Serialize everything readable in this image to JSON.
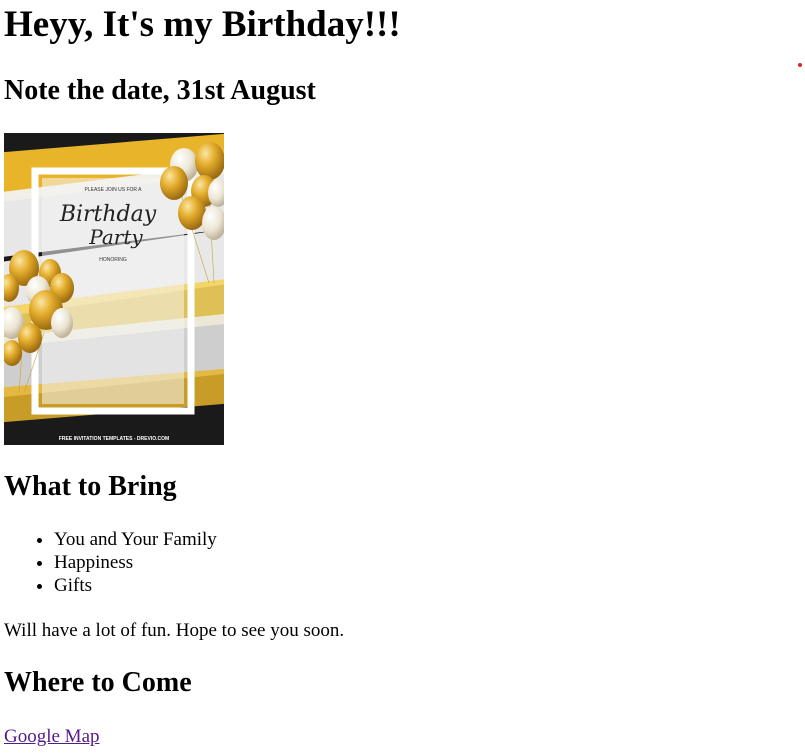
{
  "title": "Heyy, It's my Birthday!!!",
  "date_heading": "Note the date, 31st August",
  "invite_card": {
    "line1": "PLEASE JOIN US FOR A",
    "script1": "Birthday",
    "script2": "Party",
    "line2": "HONORING",
    "footer": "FREE INVITATION TEMPLATES - DREVIO.COM",
    "colors": {
      "gold": "#e8b52a",
      "dark": "#1a1a1a",
      "frame": "#ffffff"
    }
  },
  "bring_heading": "What to Bring",
  "bring_items": [
    "You and Your Family",
    "Happiness",
    "Gifts"
  ],
  "closing_text": "Will have a lot of fun. Hope to see you soon.",
  "where_heading": "Where to Come",
  "map_link": "Google Map",
  "colors": {
    "link_visited": "#551a8b",
    "dot": "#e02424"
  }
}
